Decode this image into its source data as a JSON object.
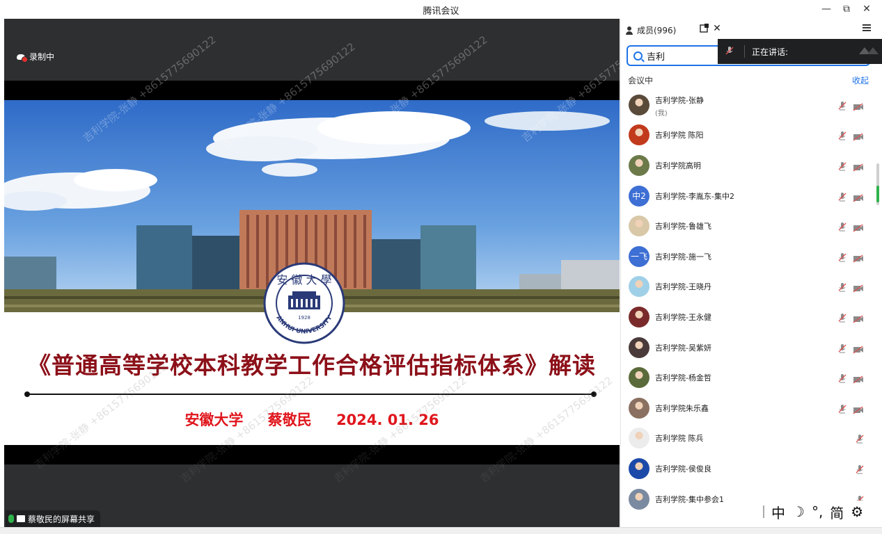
{
  "window": {
    "title": "腾讯会议",
    "minimize": "—",
    "restore": "⧉",
    "close": "✕"
  },
  "stage": {
    "recording_label": "录制中",
    "share_label": "蔡敬民的屏幕共享",
    "watermark": "吉利学院-张静 +8615775690122"
  },
  "slide": {
    "title": "《普通高等学校本科教学工作合格评估指标体系》解读",
    "org": "安徽大学",
    "speaker": "蔡敬民",
    "date": "2024. 01. 26",
    "logo_text": "ANHUI UNIVERSITY",
    "logo_year": "1928"
  },
  "panel": {
    "title": "成员(996)",
    "search_value": "吉利",
    "speaking_label": "正在讲话:",
    "section_label": "会议中",
    "collapse_label": "收起",
    "members": [
      {
        "name": "吉利学院-张静",
        "me": "(我)",
        "avatar": "photo",
        "color": "#5a4a3a",
        "cam": true
      },
      {
        "name": "吉利学院 陈阳",
        "me": "",
        "avatar": "photo",
        "color": "#c23a1c",
        "cam": true
      },
      {
        "name": "吉利学院高明",
        "me": "",
        "avatar": "photo",
        "color": "#6c7a4a",
        "cam": true
      },
      {
        "name": "吉利学院-李胤东-集中2",
        "me": "",
        "avatar": "中2",
        "color": "#3d6fd4",
        "cam": true
      },
      {
        "name": "吉利学院-鲁雄飞",
        "me": "",
        "avatar": "photo",
        "color": "#d9c8a8",
        "cam": true
      },
      {
        "name": "吉利学院-施一飞",
        "me": "",
        "avatar": "一飞",
        "color": "#3d6fd4",
        "cam": true
      },
      {
        "name": "吉利学院-王晓丹",
        "me": "",
        "avatar": "photo",
        "color": "#9fd0e8",
        "cam": true
      },
      {
        "name": "吉利学院-王永健",
        "me": "",
        "avatar": "photo",
        "color": "#7a2a2a",
        "cam": true
      },
      {
        "name": "吉利学院-吴紫妍",
        "me": "",
        "avatar": "photo",
        "color": "#4a3a3a",
        "cam": true
      },
      {
        "name": "吉利学院-杨金哲",
        "me": "",
        "avatar": "photo",
        "color": "#5a6a3a",
        "cam": true
      },
      {
        "name": "吉利学院朱乐鑫",
        "me": "",
        "avatar": "photo",
        "color": "#8a7060",
        "cam": true
      },
      {
        "name": "吉利学院 陈兵",
        "me": "",
        "avatar": "photo",
        "color": "#ececec",
        "cam": false
      },
      {
        "name": "吉利学院-侯俊良",
        "me": "",
        "avatar": "photo",
        "color": "#1c4aa8",
        "cam": false
      },
      {
        "name": "吉利学院-集中参会1",
        "me": "",
        "avatar": "photo",
        "color": "#7a8aa0",
        "cam": false
      }
    ]
  },
  "ime": {
    "mode": "中",
    "moon": "☽",
    "punct": "°,",
    "script": "简",
    "settings": "⚙"
  }
}
